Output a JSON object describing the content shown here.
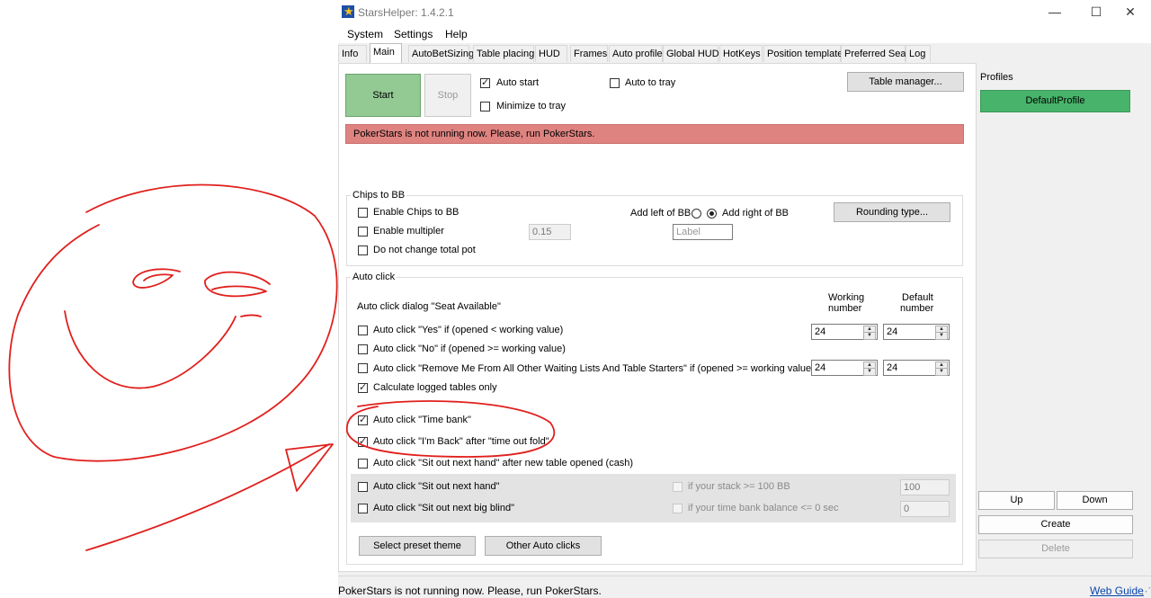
{
  "window": {
    "title": "StarsHelper: 1.4.2.1",
    "min_glyph": "—",
    "max_glyph": "☐",
    "close_glyph": "✕"
  },
  "menu": [
    "System",
    "Settings",
    "Help"
  ],
  "tabs": [
    "Info",
    "Main",
    "AutoBetSizing",
    "Table placing",
    "HUD",
    "Frames",
    "Auto profile",
    "Global HUD",
    "HotKeys",
    "Position template",
    "Preferred Seat",
    "Log"
  ],
  "active_tab": "Main",
  "main": {
    "start_label": "Start",
    "stop_label": "Stop",
    "auto_start_label": "Auto start",
    "auto_start_checked": true,
    "minimize_to_tray_label": "Minimize to tray",
    "auto_to_tray_label": "Auto to tray",
    "table_manager_label": "Table manager...",
    "error_message": "PokerStars is not running now. Please, run PokerStars."
  },
  "chips": {
    "group_title": "Chips to BB",
    "enable_chips_label": "Enable Chips to BB",
    "enable_multiplier_label": "Enable multipler",
    "multiplier_value": "0.15",
    "do_not_change_label": "Do not change total pot",
    "add_left_label": "Add left of BB",
    "add_right_label": "Add right of BB",
    "label_placeholder": "Label",
    "rounding_label": "Rounding type..."
  },
  "autoclick": {
    "group_title": "Auto click",
    "dialog_label": "Auto click dialog \"Seat Available\"",
    "working_header_1": "Working",
    "working_header_2": "number",
    "default_header_1": "Default",
    "default_header_2": "number",
    "yes_label": "Auto click \"Yes\" if (opened < working value)",
    "yes_working": "24",
    "yes_default": "24",
    "no_label": "Auto click \"No\" if (opened >= working value)",
    "remove_label": "Auto click \"Remove Me From All Other Waiting Lists And Table Starters\" if (opened >= working value)",
    "remove_working": "24",
    "remove_default": "24",
    "calc_label": "Calculate logged tables only",
    "timebank_label": "Auto click \"Time bank\"",
    "imback_label": "Auto click \"I'm Back\" after \"time out fold\"",
    "sitout_after_new_label": "Auto click \"Sit out next hand\" after new table opened (cash)",
    "sitout_next_hand_label": "Auto click \"Sit out next hand\"",
    "stack_label": "if your stack >= 100 BB",
    "stack_value": "100",
    "sitout_bb_label": "Auto click \"Sit out next big blind\"",
    "timebank_balance_label": "if your time bank balance <= 0 sec",
    "timebank_balance_value": "0",
    "preset_label": "Select preset theme",
    "other_label": "Other Auto clicks"
  },
  "profiles": {
    "title": "Profiles",
    "items": [
      "DefaultProfile"
    ],
    "up_label": "Up",
    "down_label": "Down",
    "create_label": "Create",
    "delete_label": "Delete"
  },
  "status": {
    "text": "PokerStars is not running now. Please, run PokerStars.",
    "link": "Web Guide",
    "grip": "⋰"
  },
  "colors": {
    "start_green": "#93c993",
    "profile_green": "#48b36a",
    "error_red": "#de8380",
    "annotation_red": "#e0201d"
  }
}
